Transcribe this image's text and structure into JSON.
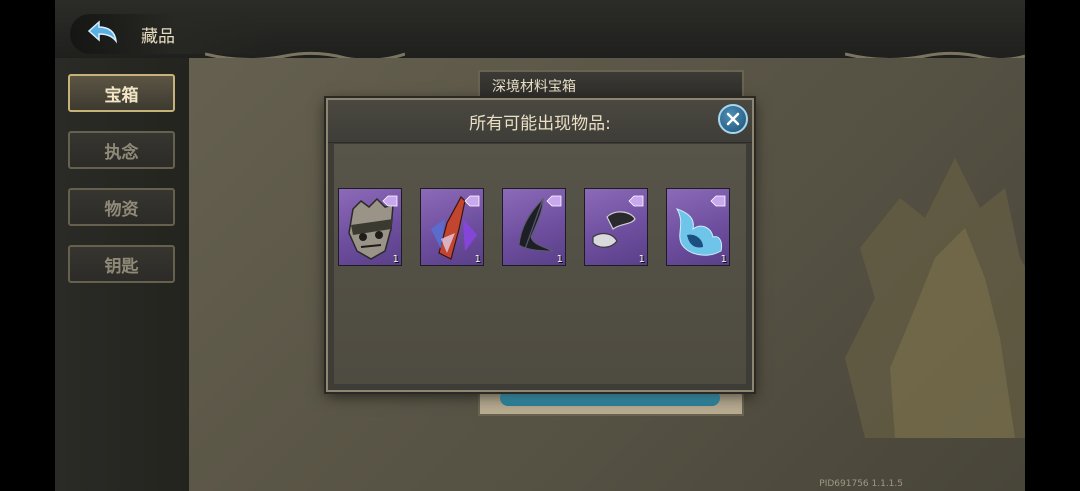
{
  "header": {
    "title": "藏品",
    "back_icon": "back-arrow-icon"
  },
  "sidebar": {
    "items": [
      {
        "label": "宝箱",
        "active": true
      },
      {
        "label": "执念",
        "active": false
      },
      {
        "label": "物资",
        "active": false
      },
      {
        "label": "钥匙",
        "active": false
      }
    ]
  },
  "chest_panel": {
    "title": "深境材料宝箱"
  },
  "modal": {
    "title": "所有可能出现物品:",
    "close_icon": "close-icon",
    "items": [
      {
        "icon": "stone-mask-icon",
        "qty": "1"
      },
      {
        "icon": "crystal-shard-icon",
        "qty": "1"
      },
      {
        "icon": "black-feather-icon",
        "qty": "1"
      },
      {
        "icon": "stone-fragment-icon",
        "qty": "1"
      },
      {
        "icon": "blue-flame-icon",
        "qty": "1"
      }
    ]
  },
  "footer": {
    "version": "PID691756  1.1.1.5"
  },
  "colors": {
    "accent_blue": "#4d8fb8",
    "item_rarity_purple": "#7a5aa8",
    "text_gold": "#e9dfc4"
  }
}
